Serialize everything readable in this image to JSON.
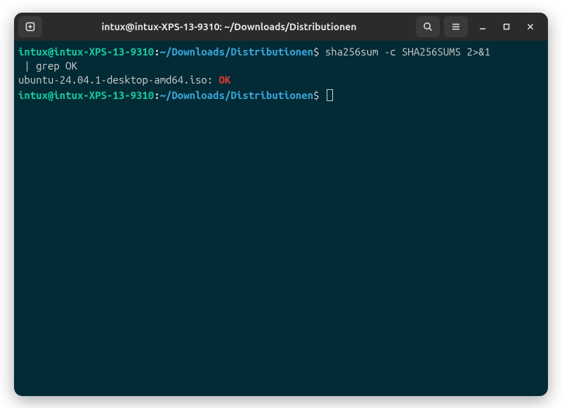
{
  "window": {
    "title": "intux@intux-XPS-13-9310: ~/Downloads/Distributionen"
  },
  "prompt": {
    "user_host": "intux@intux-XPS-13-9310",
    "colon": ":",
    "path": "~/Downloads/Distributionen",
    "sigil": "$"
  },
  "lines": {
    "cmd1_part1": "sha256sum -c SHA256SUMS 2>&1",
    "cmd1_part2": " | grep OK",
    "result_file": "ubuntu-24.04.1-desktop-amd64.iso: ",
    "result_status": "OK"
  },
  "icons": {
    "new_tab": "new-tab-icon",
    "search": "search-icon",
    "menu": "hamburger-menu-icon",
    "minimize": "minimize-icon",
    "maximize": "maximize-icon",
    "close": "close-icon"
  }
}
